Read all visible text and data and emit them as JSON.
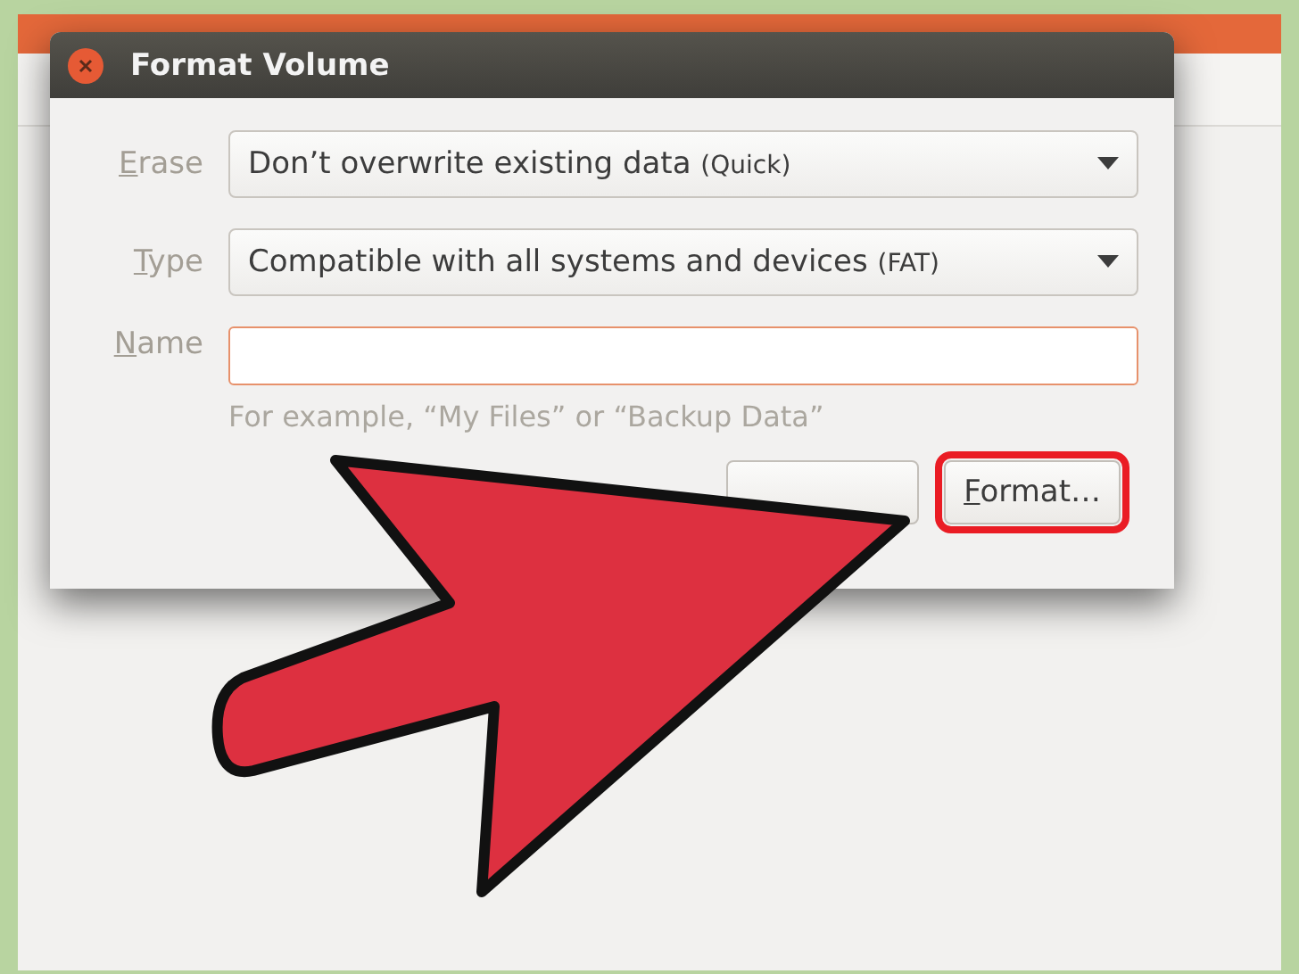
{
  "window": {
    "title": "Format Volume"
  },
  "fields": [
    {
      "kind": "dropdown",
      "label": "Erase",
      "value": "Don’t overwrite existing data",
      "note": "(Quick)"
    },
    {
      "kind": "dropdown",
      "label": "Type",
      "value": "Compatible with all systems and devices",
      "note": "(FAT)"
    },
    {
      "kind": "text",
      "label": "Name",
      "focused": true,
      "hint": "For example, “My Files” or “Backup Data”"
    }
  ],
  "buttons": [
    {
      "kind": "covered"
    },
    {
      "kind": "action",
      "label": "Format…",
      "highlighted": true
    }
  ]
}
